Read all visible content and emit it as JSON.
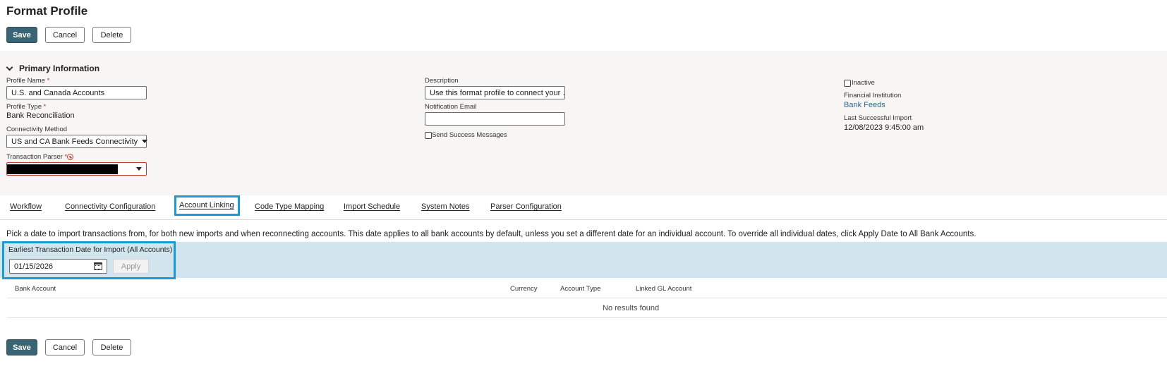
{
  "page": {
    "title": "Format Profile"
  },
  "toolbar": {
    "save_label": "Save",
    "cancel_label": "Cancel",
    "delete_label": "Delete"
  },
  "primary": {
    "section_title": "Primary Information",
    "profile_name_label": "Profile Name",
    "profile_name_value": "U.S. and Canada Accounts",
    "profile_type_label": "Profile Type",
    "profile_type_value": "Bank Reconciliation",
    "connectivity_label": "Connectivity Method",
    "connectivity_value": "US and CA Bank Feeds Connectivity",
    "parser_label": "Transaction Parser",
    "description_label": "Description",
    "description_value": "Use this format profile to connect your …",
    "notification_label": "Notification Email",
    "notification_value": "",
    "send_success_label": "Send Success Messages",
    "inactive_label": "Inactive",
    "financial_institution_label": "Financial Institution",
    "financial_institution_value": "Bank Feeds",
    "last_import_label": "Last Successful Import",
    "last_import_value": "12/08/2023 9:45:00 am",
    "required_mark": "*"
  },
  "tabs": [
    {
      "label": "Workflow"
    },
    {
      "label": "Connectivity Configuration"
    },
    {
      "label": "Account Linking"
    },
    {
      "label": "Code Type Mapping"
    },
    {
      "label": "Import Schedule"
    },
    {
      "label": "System Notes"
    },
    {
      "label": "Parser Configuration"
    }
  ],
  "account_linking": {
    "info_text": "Pick a date to import transactions from, for both new imports and when reconnecting accounts. This date applies to all bank accounts by default, unless you set a different date for an individual account. To override all individual dates, click Apply Date to All Bank Accounts.",
    "date_label": "Earliest Transaction Date for Import (All Accounts)",
    "date_value": "01/15/2026",
    "apply_label": "Apply",
    "columns": [
      "Bank Account",
      "Currency",
      "Account Type",
      "Linked GL Account"
    ],
    "empty_text": "No results found"
  },
  "colors": {
    "primary_button": "#386474",
    "highlight": "#1a9bd7",
    "band": "#d2e4ed",
    "link": "#2e6a86"
  }
}
